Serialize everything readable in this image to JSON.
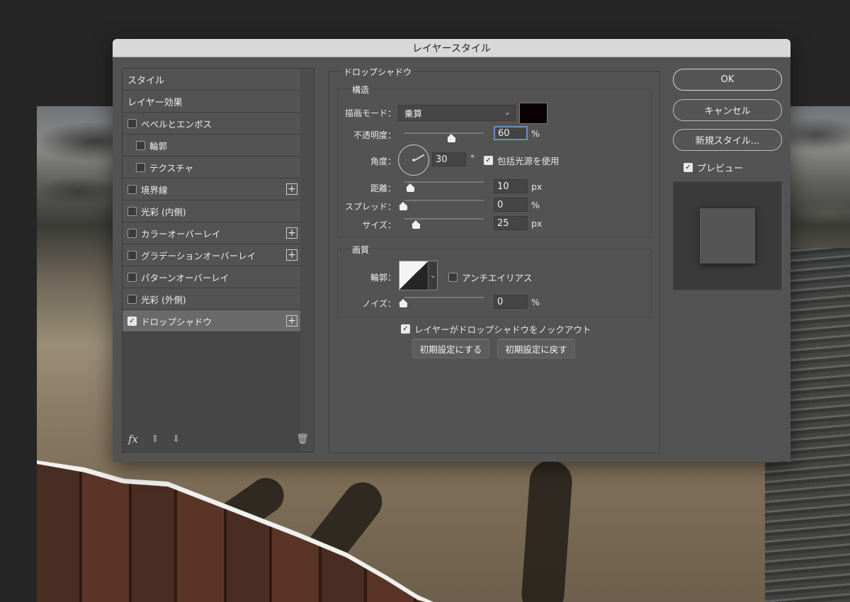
{
  "dialog": {
    "title": "レイヤースタイル"
  },
  "styles_list": {
    "items": [
      {
        "label": "スタイル",
        "type": "header"
      },
      {
        "label": "レイヤー効果",
        "type": "header"
      },
      {
        "label": "ベベルとエンボス",
        "checked": false,
        "plus": false,
        "indent": false
      },
      {
        "label": "輪郭",
        "checked": false,
        "plus": false,
        "indent": true
      },
      {
        "label": "テクスチャ",
        "checked": false,
        "plus": false,
        "indent": true
      },
      {
        "label": "境界線",
        "checked": false,
        "plus": true,
        "indent": false
      },
      {
        "label": "光彩 (内側)",
        "checked": false,
        "plus": false,
        "indent": false
      },
      {
        "label": "カラーオーバーレイ",
        "checked": false,
        "plus": true,
        "indent": false
      },
      {
        "label": "グラデーションオーバーレイ",
        "checked": false,
        "plus": true,
        "indent": false
      },
      {
        "label": "パターンオーバーレイ",
        "checked": false,
        "plus": false,
        "indent": false
      },
      {
        "label": "光彩 (外側)",
        "checked": false,
        "plus": false,
        "indent": false
      },
      {
        "label": "ドロップシャドウ",
        "checked": true,
        "plus": true,
        "indent": false,
        "selected": true
      }
    ],
    "footer": {
      "fx": "fx"
    }
  },
  "drop_shadow": {
    "title": "ドロップシャドウ",
    "structure": {
      "title": "構造",
      "blend_mode_label": "描画モード：",
      "blend_mode_value": "乗算",
      "shadow_color": "#0a0202",
      "opacity_label": "不透明度：",
      "opacity_value": "60",
      "opacity_unit": "%",
      "opacity_level": 0.6,
      "angle_label": "角度：",
      "angle_value": "30",
      "angle_unit": "°",
      "global_light_label": "包括光源を使用",
      "global_light_checked": true,
      "distance_label": "距離：",
      "distance_value": "10",
      "distance_unit": "px",
      "spread_label": "スプレッド：",
      "spread_value": "0",
      "spread_unit": "%",
      "size_label": "サイズ：",
      "size_value": "25",
      "size_unit": "px"
    },
    "quality": {
      "title": "画質",
      "contour_label": "輪郭：",
      "antialias_label": "アンチエイリアス",
      "antialias_checked": false,
      "noise_label": "ノイズ：",
      "noise_value": "0",
      "noise_unit": "%"
    },
    "knockout_label": "レイヤーがドロップシャドウをノックアウト",
    "knockout_checked": true,
    "make_default_label": "初期設定にする",
    "reset_default_label": "初期設定に戻す"
  },
  "actions": {
    "ok_label": "OK",
    "cancel_label": "キャンセル",
    "new_style_label": "新規スタイル...",
    "preview_label": "プレビュー",
    "preview_checked": true
  }
}
